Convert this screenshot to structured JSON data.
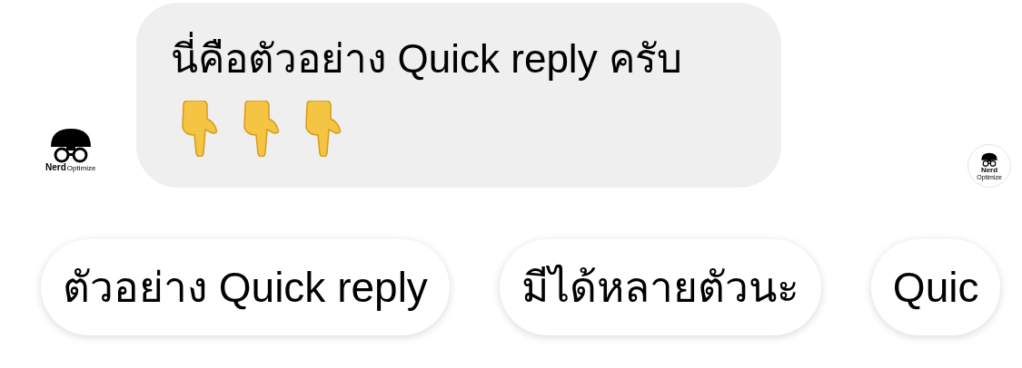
{
  "message": {
    "text": "นี่คือตัวอย่าง Quick reply ครับ",
    "emojis": [
      {
        "kind": "point-down"
      },
      {
        "kind": "point-down"
      },
      {
        "kind": "point-down"
      }
    ]
  },
  "avatars": [
    {
      "brand": "Nerd",
      "tagline": "Optimize"
    },
    {
      "brand": "Nerd",
      "tagline": "Optimize"
    }
  ],
  "quick_replies": [
    "ตัวอย่าง Quick reply",
    "มีได้หลายตัวนะ",
    "Quic"
  ]
}
